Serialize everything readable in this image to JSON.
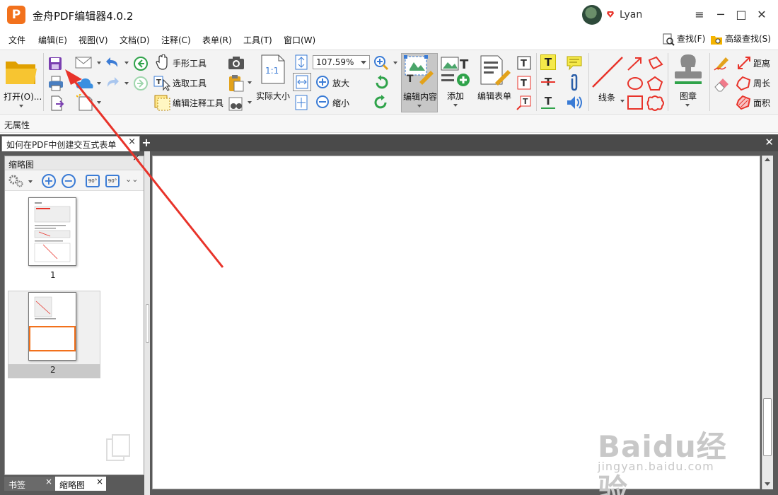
{
  "app": {
    "title": "金舟PDF编辑器4.0.2",
    "logo": "P",
    "username": "Lyan"
  },
  "window": {
    "minimize": "─",
    "maximize": "□",
    "close": "✕",
    "menu": "≡"
  },
  "menu": {
    "items": [
      "文件",
      "编辑(E)",
      "视图(V)",
      "文档(D)",
      "注释(C)",
      "表单(R)",
      "工具(T)",
      "窗口(W)"
    ],
    "find": "查找(F)",
    "advanced_find": "高级查找(S)"
  },
  "toolbar": {
    "open": "打开(O)...",
    "hand_tool": "手形工具",
    "select_tool": "选取工具",
    "edit_annotation_tool": "编辑注释工具",
    "actual_size": "实际大小",
    "zoom_value": "107.59%",
    "zoom_in": "放大",
    "zoom_out": "缩小",
    "edit_content": "编辑内容",
    "add": "添加",
    "edit_form": "编辑表单",
    "lines": "线条",
    "stamp": "图章",
    "distance": "距离",
    "perimeter": "周长",
    "area": "面积",
    "actual_size_icon_text": "1:1"
  },
  "properties": {
    "label": "无属性"
  },
  "document_tab": {
    "title": "如何在PDF中创建交互式表单",
    "close": "×",
    "new_tab": "+",
    "close_all": "✕"
  },
  "left_panel": {
    "header": "缩略图",
    "close": "×",
    "rotate_left": "90°",
    "rotate_right": "90°",
    "pages": [
      "1",
      "2"
    ],
    "tabs": [
      "书签",
      "缩略图"
    ],
    "tab_close": "×"
  },
  "watermark": {
    "brand": "Baidu经验",
    "url": "jingyan.baidu.com"
  },
  "colors": {
    "arrow": "#e8332a",
    "accent": "#3a7bd5",
    "logo": "#f2711c",
    "save_icon": "#7a3fb0"
  }
}
